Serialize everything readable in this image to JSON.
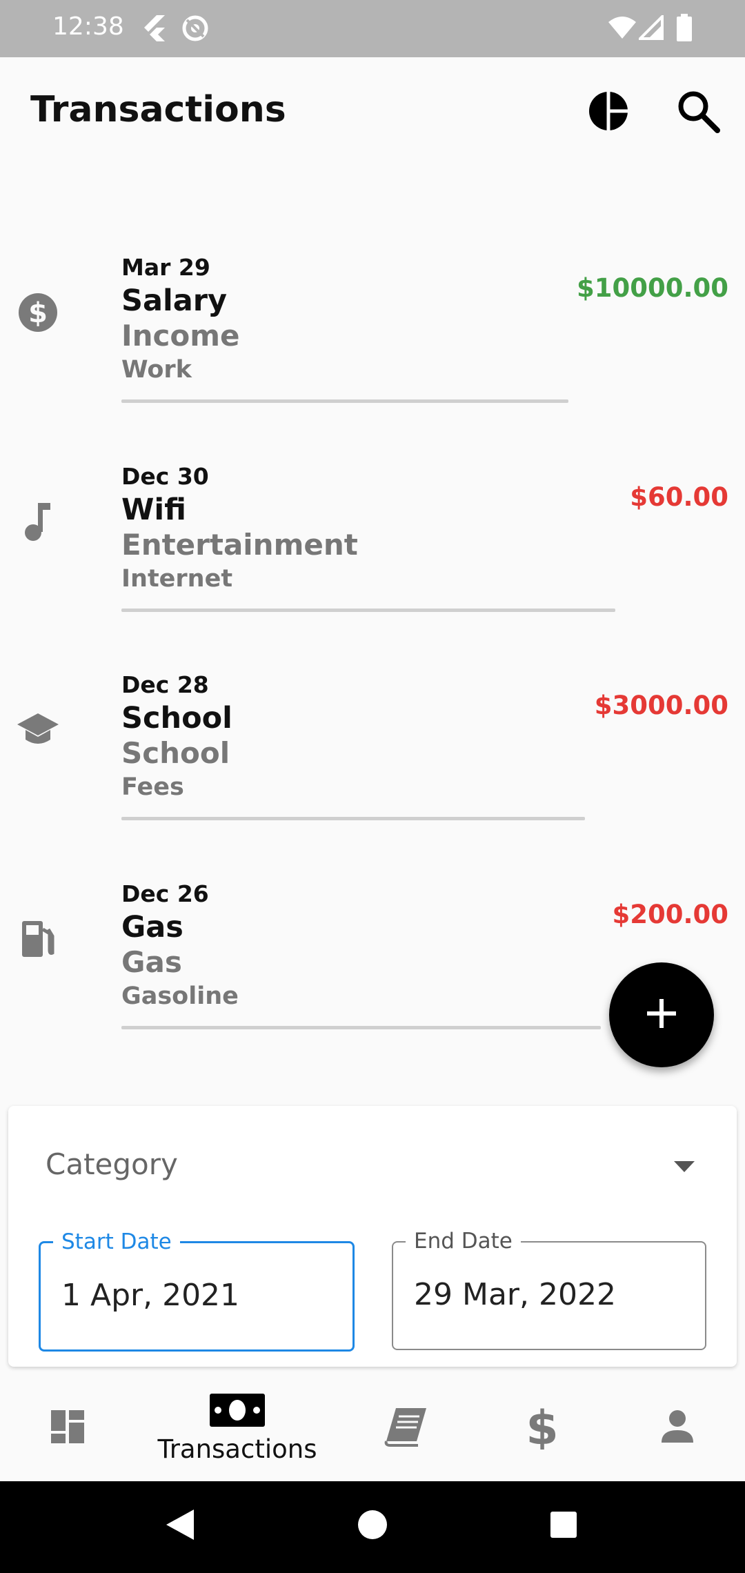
{
  "status_bar": {
    "time": "12:38"
  },
  "app_bar": {
    "title": "Transactions"
  },
  "transactions": [
    {
      "date": "Mar 29",
      "name": "Salary",
      "category": "Income",
      "subcategory": "Work",
      "amount": "$10000.00",
      "amount_color": "#43a047",
      "icon": "dollar-circle-icon"
    },
    {
      "date": "Dec 30",
      "name": "Wifi",
      "category": "Entertainment",
      "subcategory": "Internet",
      "amount": "$60.00",
      "amount_color": "#e53935",
      "icon": "music-note-icon"
    },
    {
      "date": "Dec 28",
      "name": "School",
      "category": "School",
      "subcategory": "Fees",
      "amount": "$3000.00",
      "amount_color": "#e53935",
      "icon": "graduation-cap-icon"
    },
    {
      "date": "Dec 26",
      "name": "Gas",
      "category": "Gas",
      "subcategory": "Gasoline",
      "amount": "$200.00",
      "amount_color": "#e53935",
      "icon": "gas-station-icon"
    }
  ],
  "filter": {
    "category_label": "Category",
    "start_date_label": "Start Date",
    "start_date_value": "1 Apr, 2021",
    "end_date_label": "End Date",
    "end_date_value": "29 Mar, 2022",
    "active_color": "#1e88e5"
  },
  "bottom_nav": {
    "active_label": "Transactions",
    "items": [
      {
        "icon": "dashboard-icon"
      },
      {
        "icon": "money-bill-icon",
        "label": "Transactions",
        "active": true
      },
      {
        "icon": "book-icon"
      },
      {
        "icon": "dollar-icon"
      },
      {
        "icon": "person-icon"
      }
    ]
  }
}
